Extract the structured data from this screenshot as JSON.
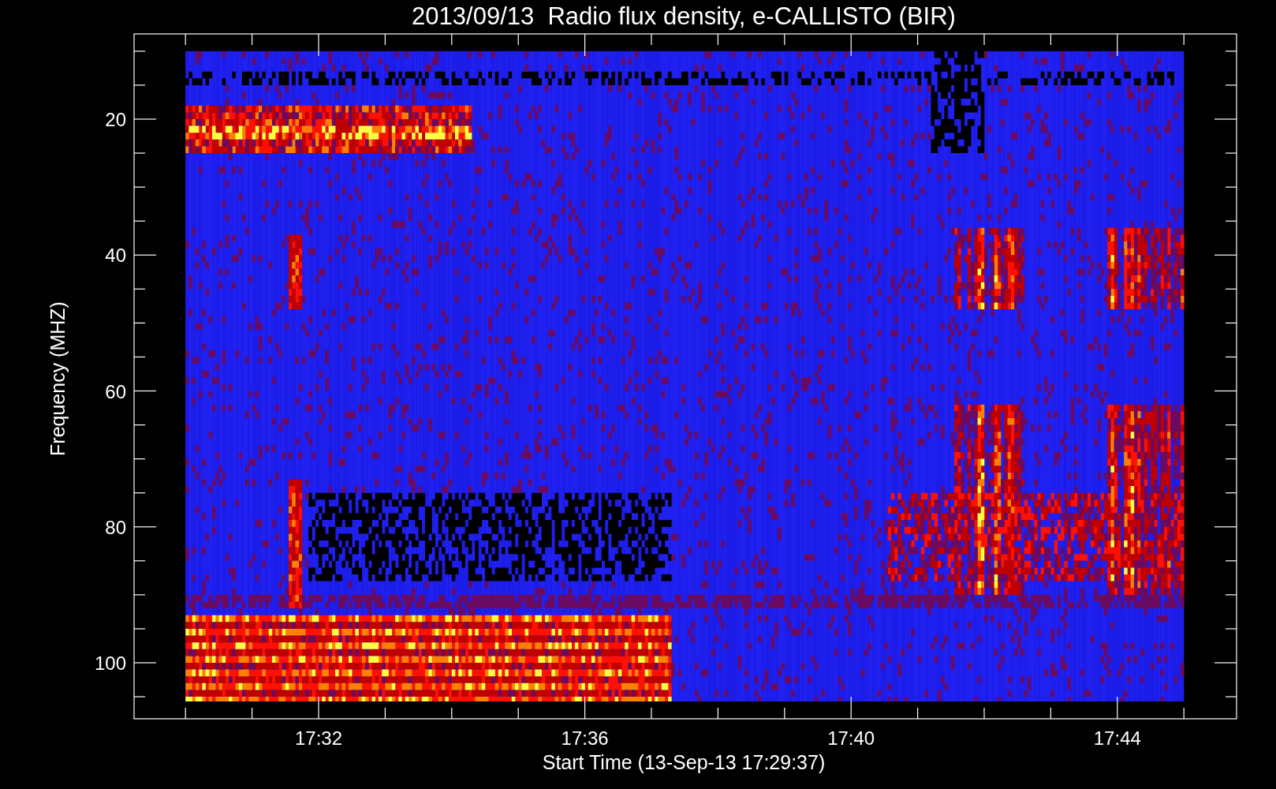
{
  "title": "2013/09/13  Radio flux density, e-CALLISTO (BIR)",
  "y_axis": {
    "label": "Frequency (MHZ)",
    "ticks": [
      "20",
      "40",
      "60",
      "80",
      "100"
    ]
  },
  "x_axis": {
    "label": "Start Time (13-Sep-13 17:29:37)",
    "ticks": [
      "17:32",
      "17:36",
      "17:40",
      "17:44"
    ]
  }
}
